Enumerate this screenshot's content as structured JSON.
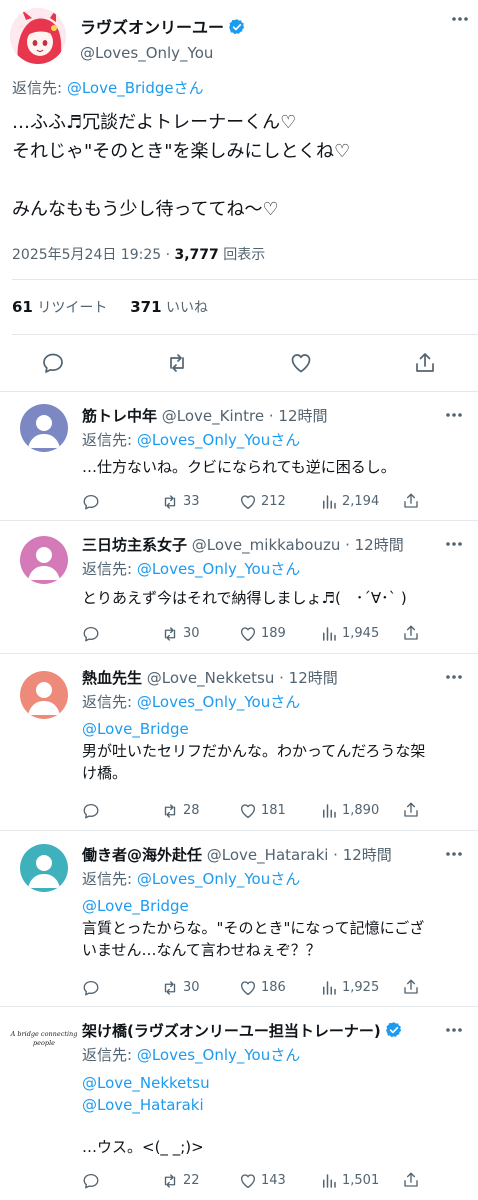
{
  "main": {
    "display_name": "ラヴズオンリーユー",
    "handle": "@Loves_Only_You",
    "reply_prefix": "返信先: ",
    "reply_to": "@Love_Bridgeさん",
    "body_line1": "…ふふ♬冗談だよトレーナーくん♡",
    "body_line2": "それじゃ\"そのとき\"を楽しみにしとくね♡",
    "body_line3": "みんなももう少し待っててね〜♡",
    "date": "2025年5月24日 19:25 · ",
    "views": "3,777",
    "views_label": " 回表示",
    "retweets": "61",
    "retweets_label": " リツイート",
    "likes": "371",
    "likes_label": " いいね",
    "icons": [
      "reply-icon",
      "retweet-icon",
      "like-icon",
      "share-icon"
    ],
    "avatar_color": "#e8364f"
  },
  "replies": [
    {
      "name": "筋トレ中年",
      "meta": " @Love_Kintre · 12時間",
      "reply_prefix": "返信先: ",
      "reply_to": "@Loves_Only_Youさん",
      "text": "…仕方ないね。クビになられても逆に困るし。",
      "retweets": "33",
      "likes": "212",
      "views": "2,194",
      "avatar_color": "#7b88c4"
    },
    {
      "name": "三日坊主系女子",
      "meta": " @Love_mikkabouzu · 12時間",
      "reply_prefix": "返信先: ",
      "reply_to": "@Loves_Only_Youさん",
      "text": "とりあえず今はそれで納得しましょ♬(　･´∀･` )",
      "retweets": "30",
      "likes": "189",
      "views": "1,945",
      "avatar_color": "#d57ab8"
    },
    {
      "name": "熱血先生",
      "meta": " @Love_Nekketsu · 12時間",
      "reply_prefix": "返信先: ",
      "reply_to": "@Loves_Only_Youさん",
      "mention1": "@Love_Bridge",
      "text_line1": "男が吐いたセリフだかんな。わかってんだろうな架",
      "text_line2": "け橋。",
      "retweets": "28",
      "likes": "181",
      "views": "1,890",
      "avatar_color": "#ee8a7a"
    },
    {
      "name": "働き者@海外赴任",
      "meta": " @Love_Hataraki · 12時間",
      "reply_prefix": "返信先: ",
      "reply_to": "@Loves_Only_Youさん",
      "mention1": "@Love_Bridge",
      "text_line1": "言質とったからな。\"そのとき\"になって記憶にござ",
      "text_line2": "いません…なんて言わせねぇぞ？？",
      "retweets": "30",
      "likes": "186",
      "views": "1,925",
      "avatar_color": "#3fb1bd"
    },
    {
      "name": "架け橋(ラヴズオンリーユー担当トレーナー)",
      "reply_prefix": "返信先: ",
      "reply_to": "@Loves_Only_Youさん",
      "mention1": "@Love_Nekketsu",
      "mention2": "@Love_Hataraki",
      "text": "…ウス。<(_ _;)>",
      "retweets": "22",
      "likes": "143",
      "views": "1,501",
      "logo_text": "A bridge connecting people"
    }
  ]
}
